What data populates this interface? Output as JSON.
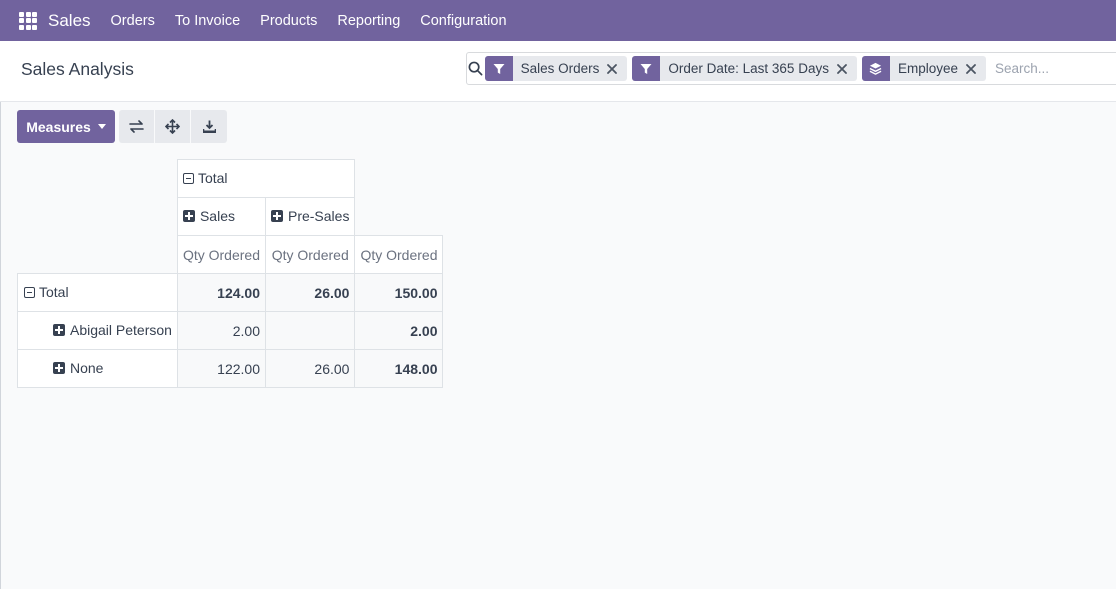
{
  "navbar": {
    "app_name": "Sales",
    "menu": [
      "Orders",
      "To Invoice",
      "Products",
      "Reporting",
      "Configuration"
    ]
  },
  "control_panel": {
    "title": "Sales Analysis",
    "search": {
      "placeholder": "Search...",
      "facets": [
        {
          "icon": "filter-icon",
          "label": "Sales Orders"
        },
        {
          "icon": "filter-icon",
          "label": "Order Date: Last 365 Days"
        },
        {
          "icon": "layers-icon",
          "label": "Employee"
        }
      ]
    }
  },
  "toolbar": {
    "measures_label": "Measures",
    "icons": [
      "flip-axis-icon",
      "expand-all-icon",
      "download-icon"
    ]
  },
  "pivot": {
    "col_total_label": "Total",
    "col_groups": [
      "Sales",
      "Pre-Sales"
    ],
    "measure_label": "Qty Ordered",
    "row_total_label": "Total",
    "total_row": [
      "124.00",
      "26.00",
      "150.00"
    ],
    "rows": [
      {
        "label": "Abigail Peterson",
        "values": [
          "2.00",
          "",
          "2.00"
        ]
      },
      {
        "label": "None",
        "values": [
          "122.00",
          "26.00",
          "148.00"
        ]
      }
    ]
  },
  "colors": {
    "brand": "#71639e",
    "facet_bg": "#e7e9ed"
  }
}
